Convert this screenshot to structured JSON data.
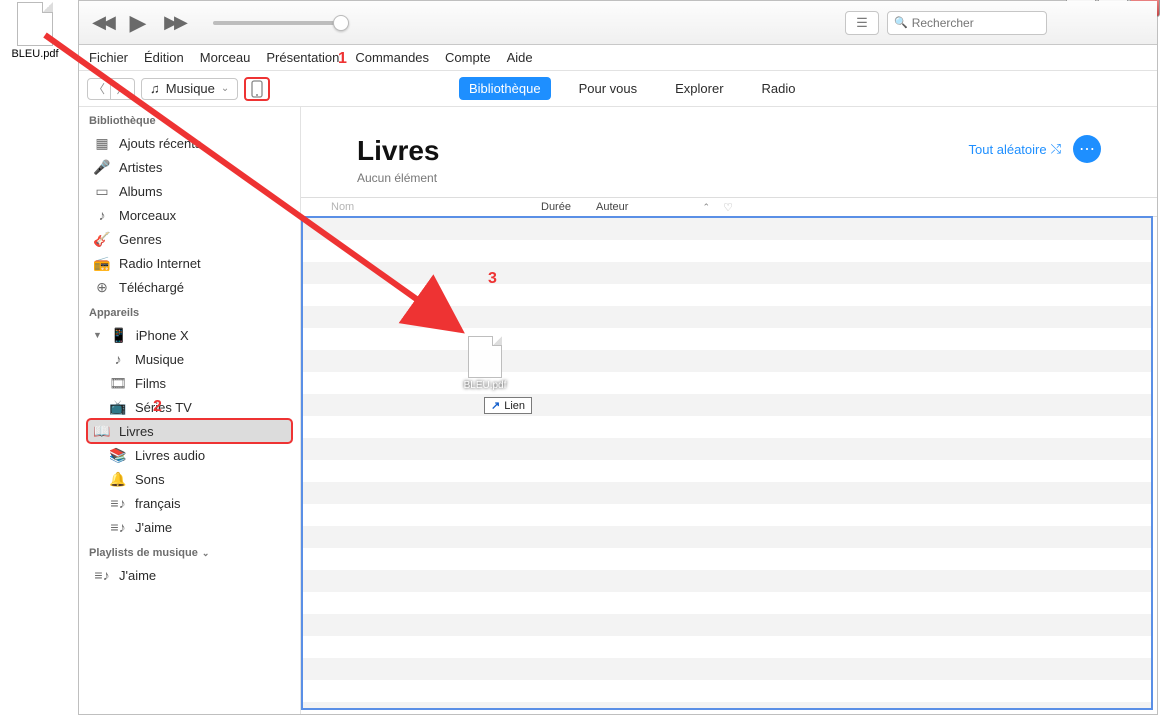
{
  "desktop_file": {
    "name": "BLEU.pdf"
  },
  "search": {
    "placeholder": "Rechercher"
  },
  "menubar": [
    "Fichier",
    "Édition",
    "Morceau",
    "Présentation",
    "Commandes",
    "Compte",
    "Aide"
  ],
  "mediadrop": {
    "label": "Musique"
  },
  "tabs": [
    {
      "label": "Bibliothèque",
      "active": true
    },
    {
      "label": "Pour vous",
      "active": false
    },
    {
      "label": "Explorer",
      "active": false
    },
    {
      "label": "Radio",
      "active": false
    }
  ],
  "sidebar": {
    "section1_title": "Bibliothèque",
    "section1_items": [
      {
        "label": "Ajouts récents",
        "icon": "grid"
      },
      {
        "label": "Artistes",
        "icon": "mic"
      },
      {
        "label": "Albums",
        "icon": "album"
      },
      {
        "label": "Morceaux",
        "icon": "note"
      },
      {
        "label": "Genres",
        "icon": "guitar"
      },
      {
        "label": "Radio Internet",
        "icon": "radio"
      },
      {
        "label": "Téléchargé",
        "icon": "download"
      }
    ],
    "section2_title": "Appareils",
    "device_name": "iPhone X",
    "device_items": [
      {
        "label": "Musique",
        "icon": "note"
      },
      {
        "label": "Films",
        "icon": "film"
      },
      {
        "label": "Séries TV",
        "icon": "tv"
      },
      {
        "label": "Livres",
        "icon": "book",
        "selected": true
      },
      {
        "label": "Livres audio",
        "icon": "abook"
      },
      {
        "label": "Sons",
        "icon": "bell"
      },
      {
        "label": "français",
        "icon": "playlist"
      },
      {
        "label": "J'aime",
        "icon": "playlist"
      }
    ],
    "section3_title": "Playlists de musique",
    "playlist_items": [
      {
        "label": "J'aime",
        "icon": "playlist"
      }
    ]
  },
  "content": {
    "title": "Livres",
    "subtitle": "Aucun élément",
    "shuffle_label": "Tout aléatoire",
    "columns": {
      "name": "Nom",
      "duration": "Durée",
      "author": "Auteur"
    }
  },
  "drag": {
    "ghost_name": "BLEU.pdf",
    "tooltip": "Lien"
  },
  "annotations": {
    "a1": "1",
    "a2": "2",
    "a3": "3"
  }
}
